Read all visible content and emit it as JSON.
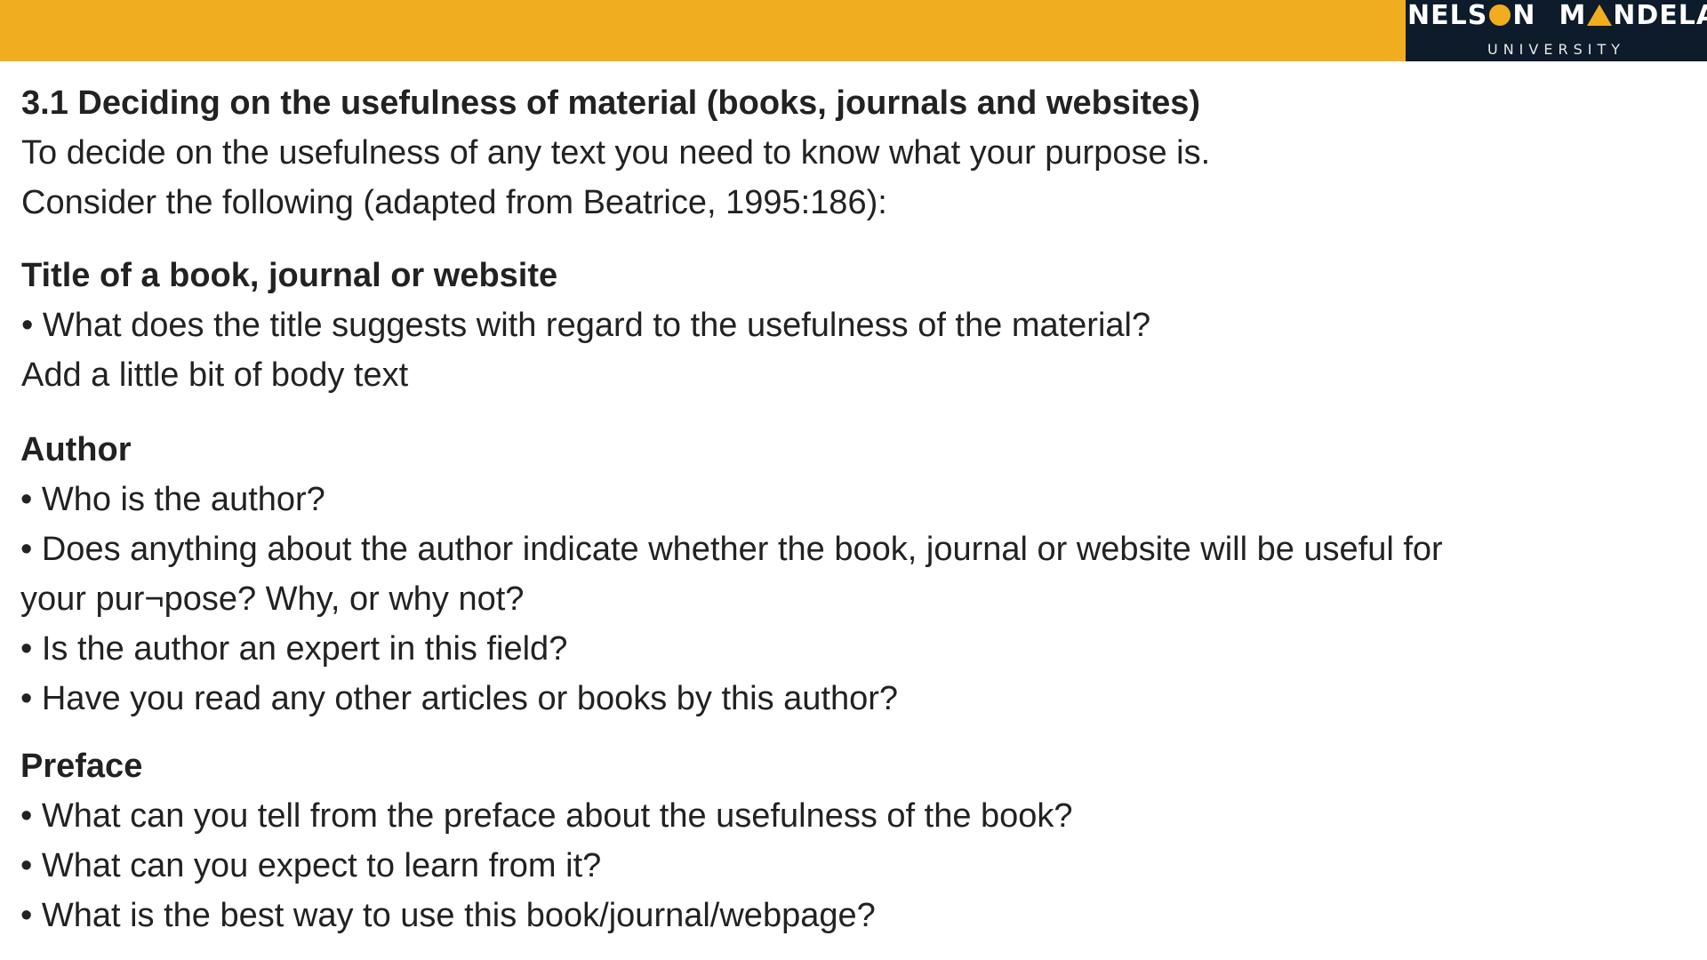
{
  "header": {
    "logo": {
      "word1_start": "NELS",
      "word1_end": "N",
      "word2_start": "M",
      "word2_end": "NDELA",
      "subtitle": "UNIVERSITY",
      "accent_color": "#f0ad1f",
      "logo_bg_color": "#0d1b2a"
    },
    "bar_color": "#f0ad1f"
  },
  "intro": {
    "title": "3.1 Deciding on the usefulness of material (books, journals and websites)",
    "line1": "To decide on the usefulness of any text you need to know what your purpose is.",
    "line2": "Consider the following (adapted from Beatrice, 1995:186):"
  },
  "sections": [
    {
      "heading": "Title of a book, journal or website",
      "lines": [
        "• What does the title suggests with regard to the usefulness of the material?",
        "Add a little bit of body text"
      ]
    },
    {
      "heading": "Author",
      "lines": [
        "• Who is the author?",
        "• Does anything about the author indicate whether the book, journal or website will be useful for",
        "your pur¬pose?  Why, or why not?",
        "• Is the author an expert in this field?",
        "• Have you read any other articles or books by this author?"
      ]
    },
    {
      "heading": "Preface",
      "lines": [
        "• What can you tell from the preface about the usefulness of the book?",
        "• What can you expect to learn from it?",
        "• What is the best way to use this book/journal/webpage?"
      ]
    }
  ]
}
